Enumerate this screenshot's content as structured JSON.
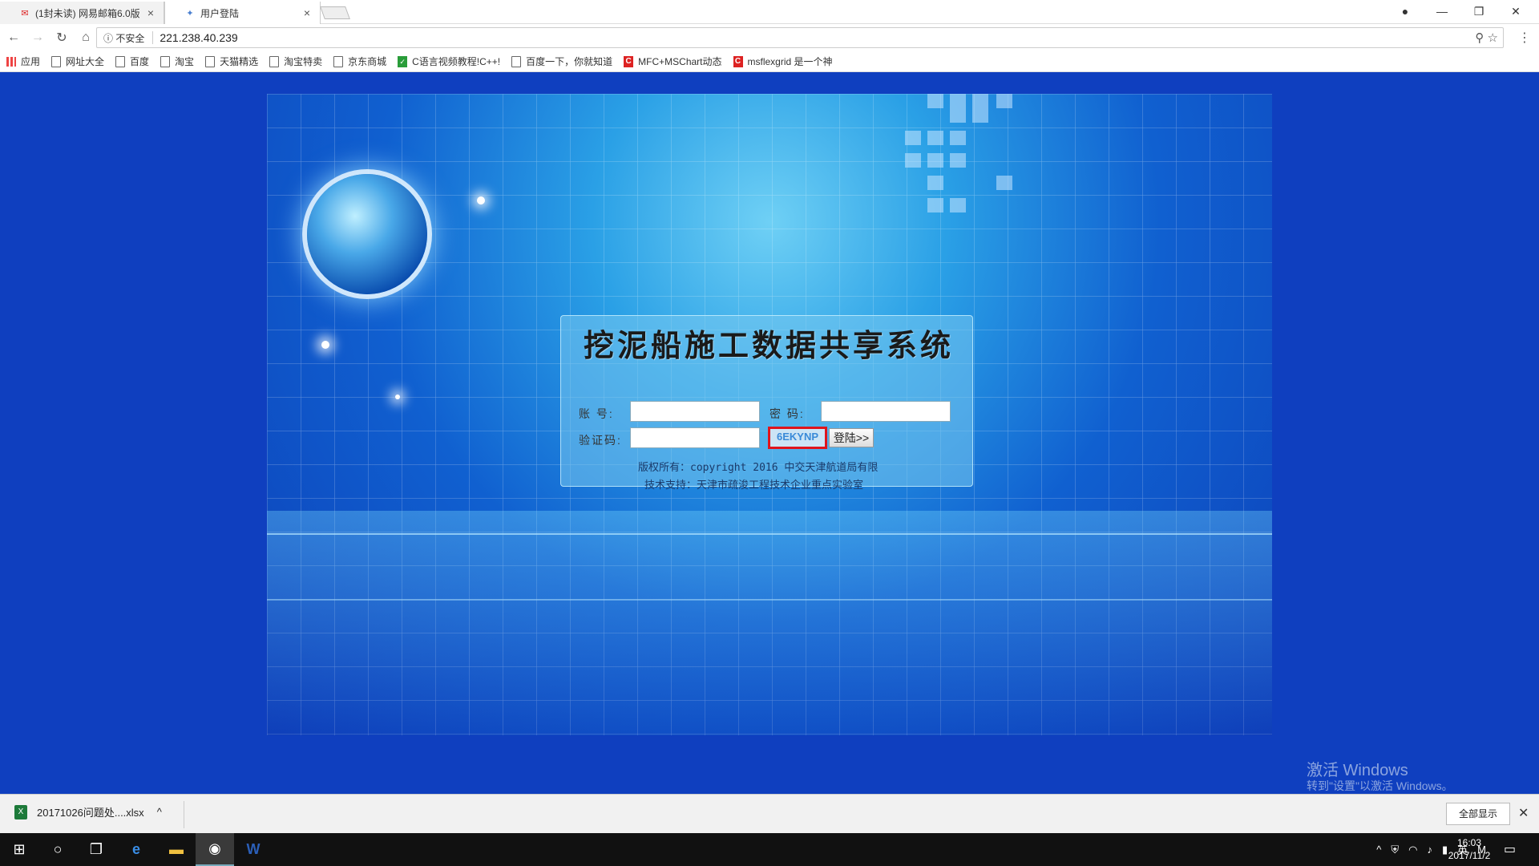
{
  "tabs": [
    {
      "title": "(1封未读) 网易邮箱6.0版",
      "icon": "netease-mail-icon",
      "close": "×"
    },
    {
      "title": "用户登陆",
      "icon": "page-icon",
      "close": "×"
    }
  ],
  "address": {
    "security": "不安全",
    "url": "221.238.40.239"
  },
  "bookmarks": [
    {
      "label": "应用",
      "icon": "apps-icon"
    },
    {
      "label": "网址大全",
      "icon": "page-icon"
    },
    {
      "label": "百度",
      "icon": "page-icon"
    },
    {
      "label": "淘宝",
      "icon": "page-icon"
    },
    {
      "label": "天猫精选",
      "icon": "page-icon"
    },
    {
      "label": "淘宝特卖",
      "icon": "page-icon"
    },
    {
      "label": "京东商城",
      "icon": "page-icon"
    },
    {
      "label": "C语言视频教程!C++!",
      "icon": "green-icon"
    },
    {
      "label": "百度一下，你就知道",
      "icon": "page-icon"
    },
    {
      "label": "MFC+MSChart动态",
      "icon": "csdn-icon"
    },
    {
      "label": "msflexgrid 是一个神",
      "icon": "csdn-icon"
    }
  ],
  "login": {
    "title": "挖泥船施工数据共享系统",
    "account_label": "账 号:",
    "password_label": "密 码:",
    "captcha_label": "验证码:",
    "captcha_code": "6EKYNP",
    "login_button": "登陆>>",
    "copyright": "版权所有：copyright 2016 中交天津航道局有限",
    "support": "技术支持：天津市疏浚工程技术企业重点实验室"
  },
  "watermark": {
    "line1": "激活 Windows",
    "line2": "转到\"设置\"以激活 Windows。"
  },
  "download": {
    "file": "20171026问题处....xlsx",
    "show_all": "全部显示"
  },
  "taskbar": {
    "ime": "英",
    "time": "16:03",
    "date": "2017/11/2"
  }
}
